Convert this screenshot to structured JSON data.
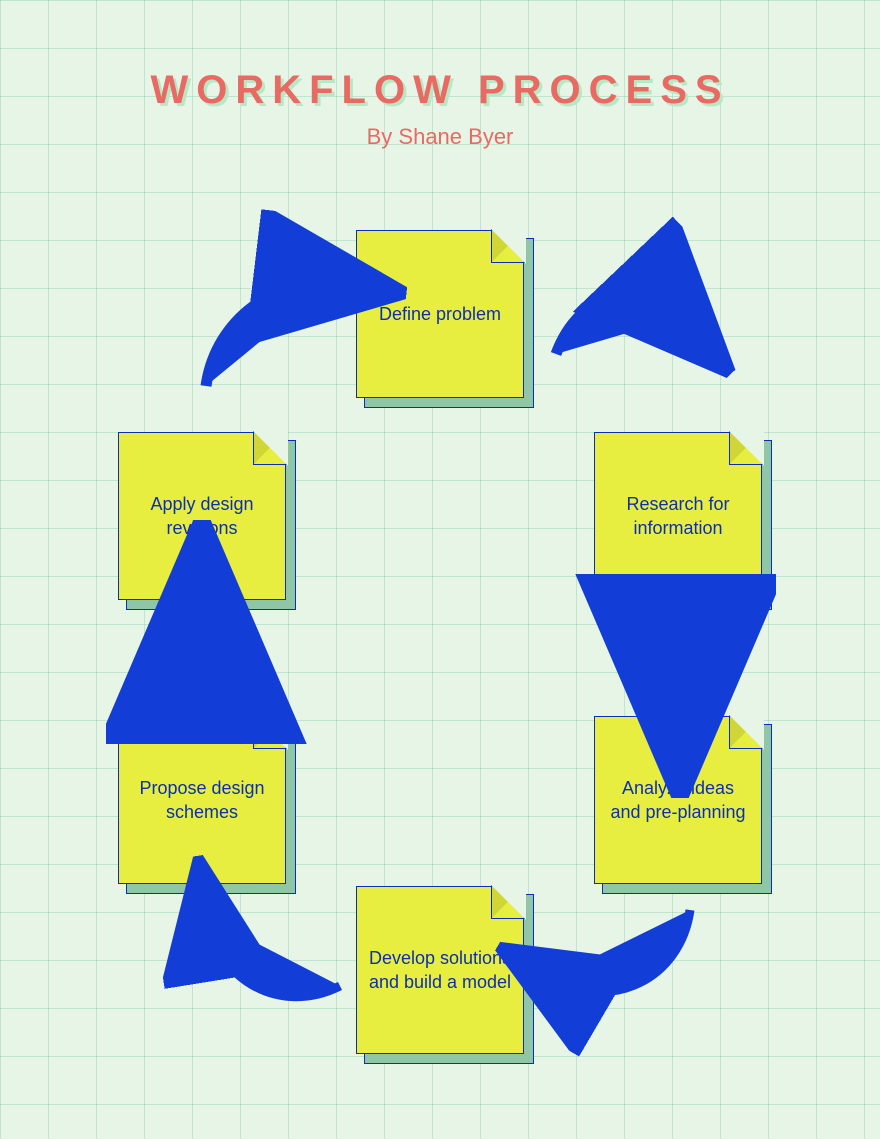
{
  "title": "WORKFLOW PROCESS",
  "byline": "By Shane Byer",
  "notes": {
    "n1": "Define problem",
    "n2": "Research for information",
    "n3": "Analyze ideas and pre-planning",
    "n4": "Develop solutions and build a model",
    "n5": "Propose design schemes",
    "n6": "Apply design revisions"
  },
  "colors": {
    "accent": "#e86a62",
    "arrow": "#123dd6",
    "note": "#e8ee3f",
    "shadow": "#8fc6a8",
    "text": "#0b2fb3"
  },
  "chart_data": {
    "type": "cycle-diagram",
    "title": "Workflow Process",
    "author": "Shane Byer",
    "steps": [
      "Define problem",
      "Research for information",
      "Analyze ideas and pre-planning",
      "Develop solutions and build a model",
      "Propose design schemes",
      "Apply design revisions"
    ],
    "direction": "clockwise",
    "closed_loop": true,
    "note": "Six-step circular workflow; each arrow points from step i to step i+1, last arrow returns to step 1."
  }
}
